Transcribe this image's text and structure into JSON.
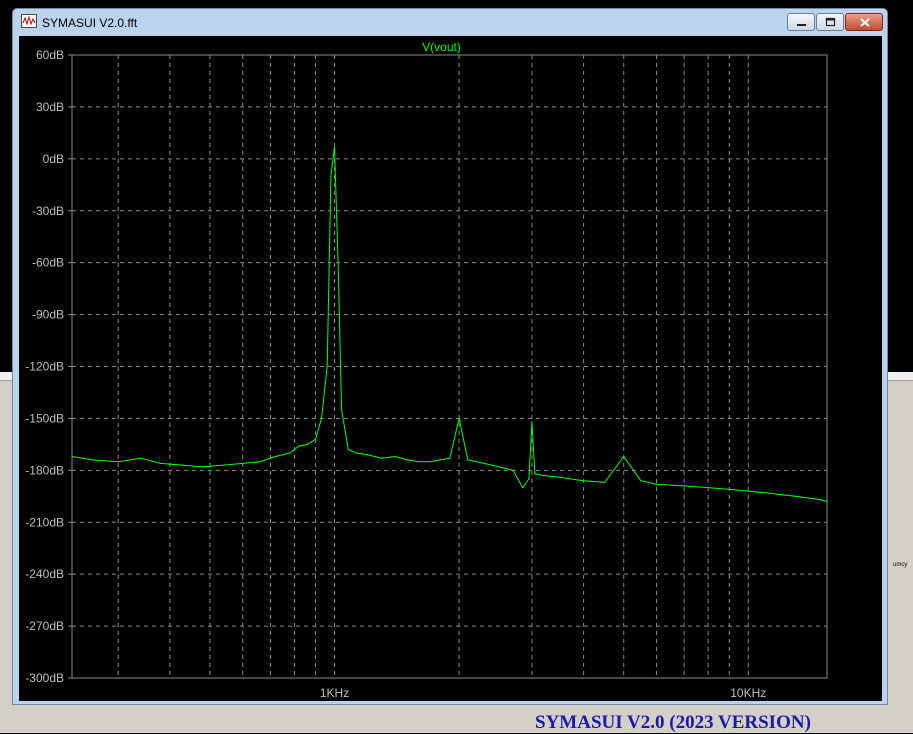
{
  "window": {
    "title": "SYMASUI V2.0.fft",
    "icon": "waveform-icon",
    "controls": [
      "minimize-icon",
      "maximize-icon",
      "close-icon"
    ]
  },
  "caption": "SYMASUI V2.0 (2023 VERSION)",
  "background_label": "umcy",
  "colors": {
    "trace": "#00ff00",
    "grid": "#8a8a8a",
    "axis_text": "#bfbfbf",
    "caption": "#1a1aa8"
  },
  "chart_data": {
    "type": "line",
    "title": "V(vout)",
    "xscale": "log",
    "xlim": [
      232,
      15500
    ],
    "ylim": [
      -300,
      60
    ],
    "y_ticks": [
      "60dB",
      "30dB",
      "0dB",
      "-30dB",
      "-60dB",
      "-90dB",
      "-120dB",
      "-150dB",
      "-180dB",
      "-210dB",
      "-240dB",
      "-270dB",
      "-300dB"
    ],
    "x_ticks": [
      {
        "value": 1000,
        "label": "1KHz"
      },
      {
        "value": 10000,
        "label": "10KHz"
      }
    ],
    "grid": true,
    "series": [
      {
        "name": "V(vout)",
        "x": [
          232,
          260,
          300,
          340,
          380,
          430,
          480,
          540,
          600,
          660,
          720,
          780,
          820,
          860,
          900,
          930,
          960,
          980,
          1000,
          1020,
          1040,
          1080,
          1130,
          1200,
          1300,
          1400,
          1500,
          1600,
          1700,
          1800,
          1900,
          2000,
          2100,
          2300,
          2500,
          2700,
          2850,
          2950,
          3000,
          3050,
          3200,
          3500,
          4000,
          4500,
          5000,
          5500,
          6000,
          7000,
          8000,
          9000,
          10000,
          11000,
          12000,
          13000,
          14000,
          15000,
          15500
        ],
        "y": [
          -172,
          -174,
          -175,
          -173,
          -176,
          -177,
          -178,
          -177,
          -176,
          -175,
          -172,
          -170,
          -166,
          -165,
          -162,
          -150,
          -120,
          -10,
          7,
          -60,
          -145,
          -168,
          -170,
          -171,
          -173,
          -172,
          -174,
          -175,
          -175,
          -174,
          -173,
          -150,
          -174,
          -176,
          -178,
          -180,
          -190,
          -185,
          -152,
          -182,
          -183,
          -184,
          -186,
          -187,
          -172,
          -186,
          -188,
          -189,
          -190,
          -191,
          -192,
          -193,
          -194,
          -195,
          -196,
          -197,
          -198
        ]
      }
    ]
  }
}
